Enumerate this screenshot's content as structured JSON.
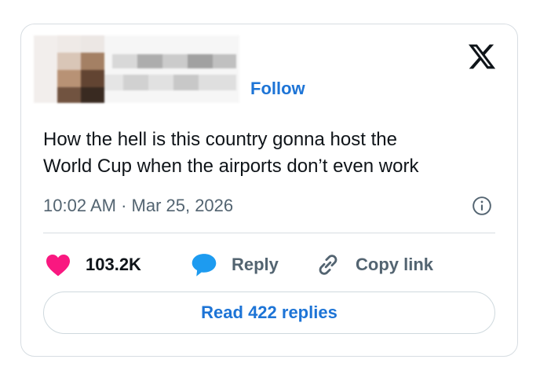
{
  "header": {
    "follow_label": "Follow"
  },
  "tweet": {
    "text": "How the hell is this country gonna host the\nWorld Cup when the airports don’t even work",
    "timestamp": "10:02 AM · Mar 25, 2026"
  },
  "actions": {
    "likes_count": "103.2K",
    "reply_label": "Reply",
    "copy_link_label": "Copy link"
  },
  "footer": {
    "read_replies_label": "Read 422 replies"
  },
  "colors": {
    "accent": "#1d74d6",
    "like": "#f91880",
    "reply": "#1d9bf0",
    "text": "#0f1419",
    "muted": "#536471",
    "border": "#d7dde2"
  },
  "icons": {
    "brand": "x-logo-icon",
    "info": "info-icon",
    "like": "heart-icon",
    "reply": "speech-bubble-icon",
    "copy": "link-icon"
  }
}
